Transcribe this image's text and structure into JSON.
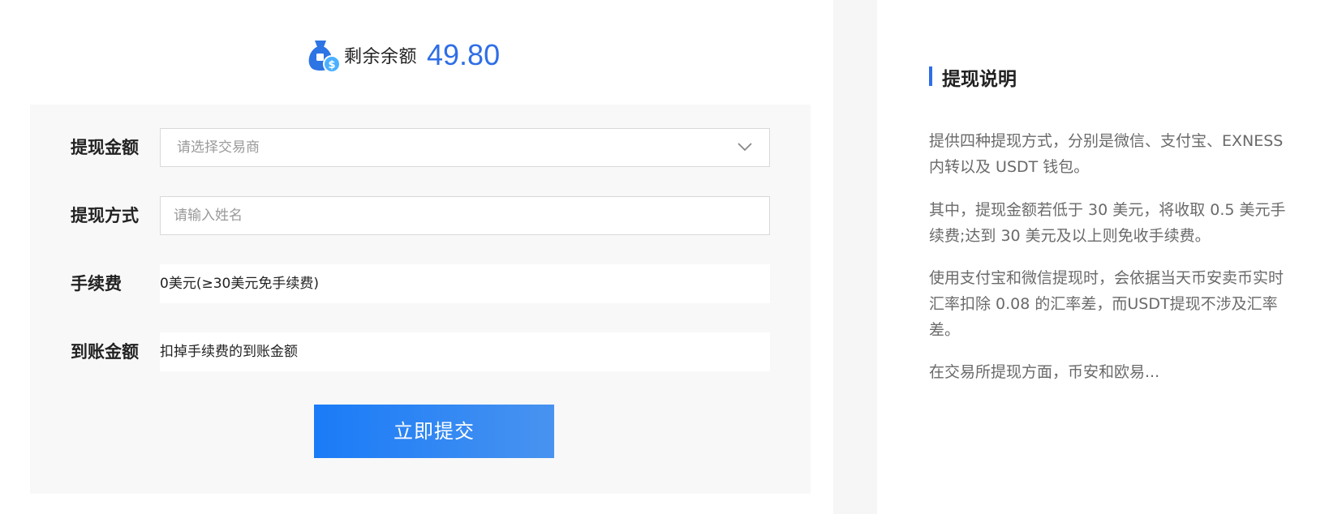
{
  "balance": {
    "label": "剩余余额",
    "value": "49.80",
    "icon": "money-bag-dollar-icon"
  },
  "form": {
    "amount": {
      "label": "提现金额",
      "placeholder": "请选择交易商"
    },
    "method": {
      "label": "提现方式",
      "placeholder": "请输入姓名"
    },
    "fee": {
      "label": "手续费",
      "value": "0美元(≥30美元免手续费)"
    },
    "received": {
      "label": "到账金额",
      "value": "扣掉手续费的到账金额"
    },
    "submit_label": "立即提交"
  },
  "info": {
    "title": "提现说明",
    "paragraphs": [
      "提供四种提现方式，分别是微信、支付宝、EXNESS内转以及 USDT 钱包。",
      "其中，提现金额若低于 30 美元，将收取 0.5 美元手续费;达到 30 美元及以上则免收手续费。",
      "使用支付宝和微信提现时，会依据当天币安卖币实时汇率扣除 0.08 的汇率差，而USDT提现不涉及汇率差。",
      "在交易所提现方面，币安和欧易..."
    ]
  },
  "colors": {
    "accent": "#2f6ee6",
    "button_start": "#1a7bf7",
    "button_end": "#4893f0",
    "card_bg": "#f8f8f8"
  }
}
